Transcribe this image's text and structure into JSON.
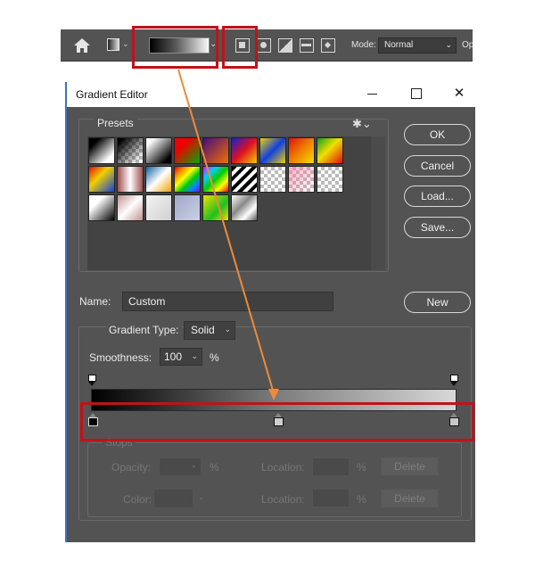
{
  "options_bar": {
    "mode_label": "Mode:",
    "mode_value": "Normal",
    "opacity_label_partial": "Op"
  },
  "dialog": {
    "title": "Gradient Editor",
    "presets_label": "Presets",
    "buttons": {
      "ok": "OK",
      "cancel": "Cancel",
      "load": "Load...",
      "save": "Save...",
      "new": "New"
    },
    "name_label": "Name:",
    "name_value": "Custom",
    "gradient_type_label": "Gradient Type:",
    "gradient_type_value": "Solid",
    "smoothness_label": "Smoothness:",
    "smoothness_value": "100",
    "smoothness_unit": "%",
    "stops": {
      "label": "Stops",
      "opacity_label": "Opacity:",
      "opacity_unit": "%",
      "location_label": "Location:",
      "location_unit": "%",
      "color_label": "Color:",
      "delete_label": "Delete"
    }
  },
  "colors": {
    "panel_bg": "#535353",
    "annotation_red": "#c0121a",
    "arrow_orange": "#ee8a3a"
  }
}
